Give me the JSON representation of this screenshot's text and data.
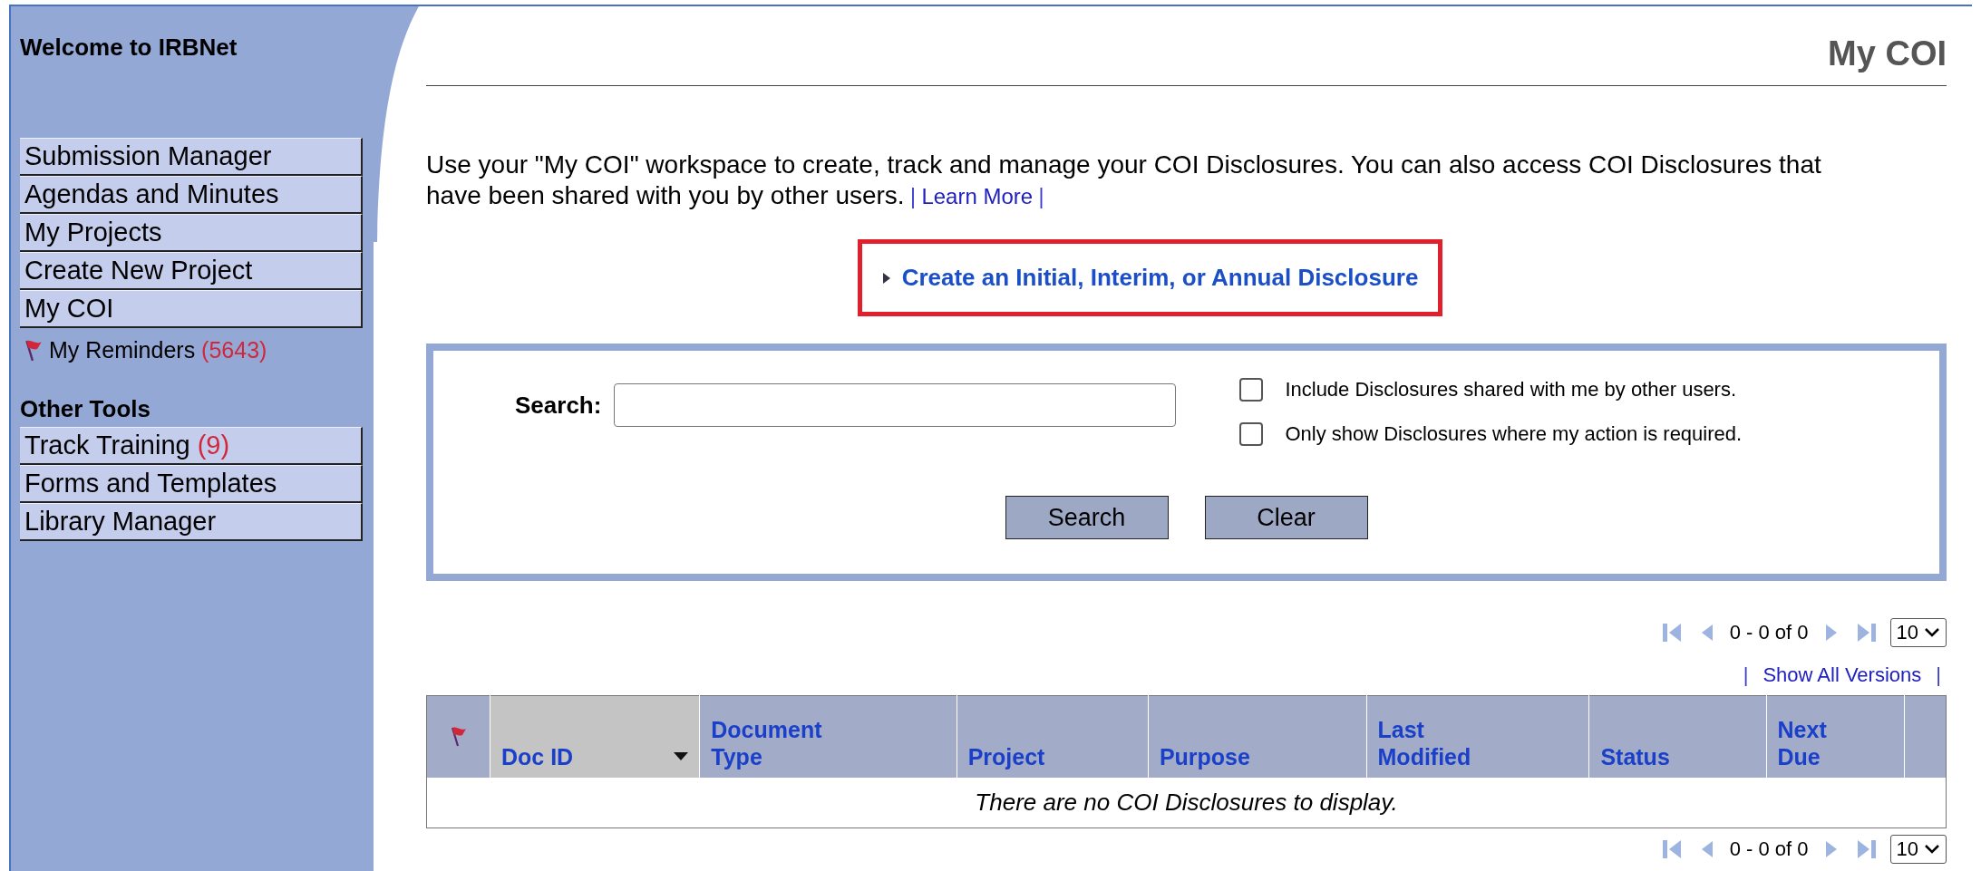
{
  "sidebar": {
    "title": "Welcome to IRBNet",
    "items": [
      {
        "label": "Submission Manager"
      },
      {
        "label": "Agendas and Minutes"
      },
      {
        "label": "My Projects"
      },
      {
        "label": "Create New Project"
      },
      {
        "label": "My COI"
      }
    ],
    "reminders": {
      "label": "My Reminders",
      "count": "(5643)"
    },
    "other_tools": {
      "heading": "Other Tools",
      "items": [
        {
          "label": "Track Training",
          "count": "(9)"
        },
        {
          "label": "Forms and Templates"
        },
        {
          "label": "Library Manager"
        }
      ]
    }
  },
  "page_title": "My COI",
  "intro": {
    "text": "Use your \"My COI\" workspace to create, track and manage your COI Disclosures. You can also access COI Disclosures that have been shared with you by other users.",
    "separator_left": "|",
    "link": "Learn More",
    "separator_right": "|"
  },
  "create_link": {
    "label": "Create an Initial, Interim, or Annual Disclosure",
    "highlighted": true
  },
  "search": {
    "label": "Search:",
    "options": [
      {
        "label": "Include Disclosures shared with me by other users.",
        "checked": false
      },
      {
        "label": "Only show Disclosures where my action is required.",
        "checked": false
      }
    ],
    "buttons": [
      "Search",
      "Clear"
    ]
  },
  "pagination_top": {
    "range": "0 - 0 of 0",
    "page_size": "10"
  },
  "versions": {
    "separator_left": "|",
    "link": "Show All Versions",
    "separator_right": "|"
  },
  "table": {
    "columns": [
      {
        "kind": "flag"
      },
      {
        "kind": "text",
        "label": "Doc ID",
        "sorted": true
      },
      {
        "kind": "text",
        "label": "Document Type",
        "sorted": false
      },
      {
        "kind": "text",
        "label": "Project",
        "sorted": false
      },
      {
        "kind": "text",
        "label": "Purpose",
        "sorted": false
      },
      {
        "kind": "text",
        "label": "Last Modified",
        "sorted": false
      },
      {
        "kind": "text",
        "label": "Status",
        "sorted": false
      },
      {
        "kind": "text",
        "label": "Next Due",
        "sorted": false
      },
      {
        "kind": "blank"
      }
    ],
    "empty_message": "There are no COI Disclosures to display."
  },
  "pagination_bottom": {
    "range": "0 - 0 of 0",
    "page_size": "10"
  }
}
